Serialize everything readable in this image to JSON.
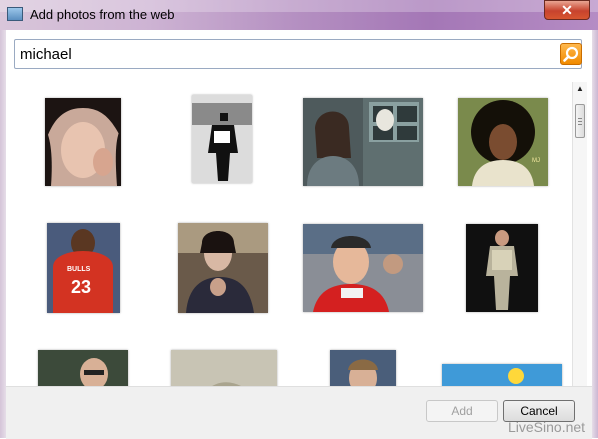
{
  "window": {
    "title": "Add photos from the web",
    "close_label": "✕",
    "app_icon": "photo-gallery-icon"
  },
  "search": {
    "value": "michael",
    "button_icon": "search-icon"
  },
  "results": [
    {
      "name": "result-photo-1"
    },
    {
      "name": "result-photo-2"
    },
    {
      "name": "result-photo-3"
    },
    {
      "name": "result-photo-4"
    },
    {
      "name": "result-photo-5"
    },
    {
      "name": "result-photo-6"
    },
    {
      "name": "result-photo-7"
    },
    {
      "name": "result-photo-8"
    },
    {
      "name": "result-photo-9"
    },
    {
      "name": "result-photo-10"
    },
    {
      "name": "result-photo-11"
    },
    {
      "name": "result-photo-12"
    }
  ],
  "thumb_text": {
    "jersey_team": "BULLS",
    "jersey_number": "23"
  },
  "scrollbar": {
    "up_arrow": "▲",
    "down_arrow": "▼"
  },
  "footer": {
    "add_label": "Add",
    "cancel_label": "Cancel"
  },
  "watermark": "LiveSino.net"
}
